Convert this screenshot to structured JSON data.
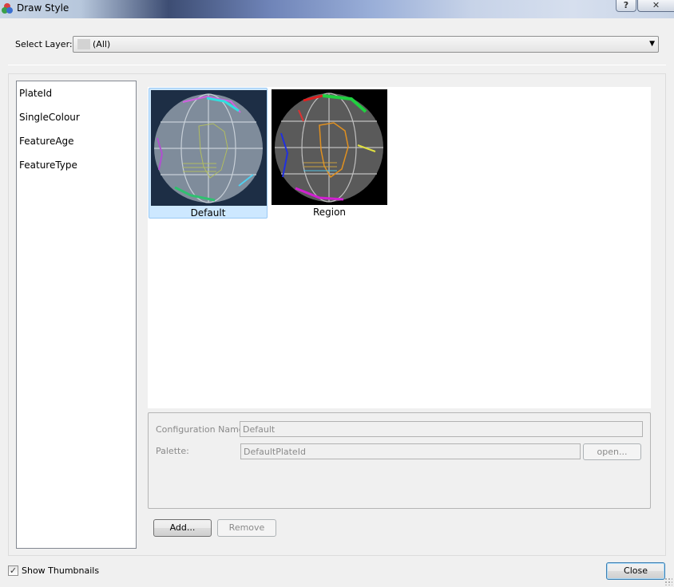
{
  "window": {
    "title": "Draw Style",
    "help_label": "?",
    "close_label": "✕"
  },
  "layer": {
    "label": "Select Layer:",
    "value": "(All)"
  },
  "style_list": [
    "PlateId",
    "SingleColour",
    "FeatureAge",
    "FeatureType"
  ],
  "thumbnails": [
    {
      "label": "Default",
      "selected": true
    },
    {
      "label": "Region",
      "selected": false
    }
  ],
  "config": {
    "name_label": "Configuration Name:",
    "name_value": "Default",
    "palette_label": "Palette:",
    "palette_value": "DefaultPlateId",
    "open_label": "open..."
  },
  "buttons": {
    "add": "Add...",
    "remove": "Remove",
    "close": "Close"
  },
  "show_thumbnails": {
    "label": "Show Thumbnails",
    "checked": true,
    "check_mark": "✓"
  },
  "colors": {
    "selection": "#cde8ff",
    "accent": "#3c7fb1"
  }
}
